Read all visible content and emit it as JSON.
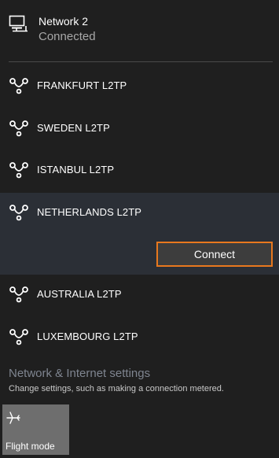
{
  "network": {
    "name": "Network 2",
    "status": "Connected",
    "icon": "desktop-network-icon"
  },
  "vpn_icon": "vpn-icon",
  "vpn_items": [
    {
      "label": "FRANKFURT L2TP"
    },
    {
      "label": "SWEDEN L2TP"
    },
    {
      "label": "ISTANBUL L2TP"
    },
    {
      "label": "NETHERLANDS L2TP",
      "selected": true
    },
    {
      "label": "AUSTRALIA L2TP"
    },
    {
      "label": "LUXEMBOURG L2TP"
    }
  ],
  "connect_button": {
    "label": "Connect",
    "border_color": "#e8781e"
  },
  "settings": {
    "link": "Network & Internet settings",
    "description": "Change settings, such as making a connection metered."
  },
  "quick_actions": [
    {
      "label": "Flight mode",
      "icon": "airplane-icon"
    }
  ]
}
